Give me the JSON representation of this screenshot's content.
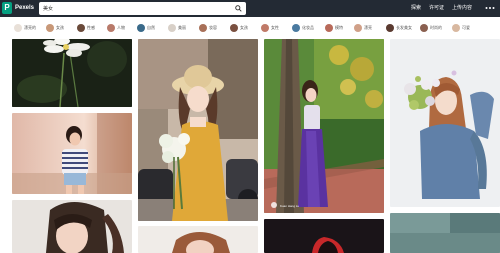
{
  "header": {
    "logo_letter": "P",
    "brand": "Pexels",
    "search": {
      "value": "美女",
      "placeholder": ""
    },
    "links": [
      "探索",
      "许可证",
      "上传内容"
    ],
    "more_icon": "ellipsis-icon"
  },
  "tags": [
    {
      "label": "漂亮的",
      "color": "#e8e0d8"
    },
    {
      "label": "女孩",
      "color": "#c89878"
    },
    {
      "label": "性感",
      "color": "#6a4a3a"
    },
    {
      "label": "人物",
      "color": "#b87a6a"
    },
    {
      "label": "自然",
      "color": "#3a6a8a"
    },
    {
      "label": "美丽",
      "color": "#d8d0c8"
    },
    {
      "label": "妆容",
      "color": "#a87058"
    },
    {
      "label": "女孩",
      "color": "#7a5040"
    },
    {
      "label": "女性",
      "color": "#c07a68"
    },
    {
      "label": "化妆品",
      "color": "#4a7aa0"
    },
    {
      "label": "模特",
      "color": "#b86a5a"
    },
    {
      "label": "漂亮",
      "color": "#d0a088"
    },
    {
      "label": "长发美女",
      "color": "#5a3a30"
    },
    {
      "label": "时尚的",
      "color": "#8a6050"
    },
    {
      "label": "可爱",
      "color": "#d8b8a0"
    }
  ],
  "photos": [
    {
      "name": "photo-white-flower",
      "credit": ""
    },
    {
      "name": "photo-woman-striped-shirt",
      "credit": ""
    },
    {
      "name": "photo-woman-portrait-hair",
      "credit": ""
    },
    {
      "name": "photo-woman-sunhat-bouquet",
      "credit": ""
    },
    {
      "name": "photo-woman-red-hair",
      "credit": ""
    },
    {
      "name": "photo-woman-purple-skirt-tree",
      "credit": "Kuan Hang Lu"
    },
    {
      "name": "photo-woman-dark-red-light",
      "credit": ""
    },
    {
      "name": "photo-woman-blue-sweater-flowers",
      "credit": ""
    },
    {
      "name": "photo-dark-teal-partial",
      "credit": ""
    }
  ],
  "colors": {
    "nav_bg": "#232a34",
    "brand_green": "#05a081"
  }
}
